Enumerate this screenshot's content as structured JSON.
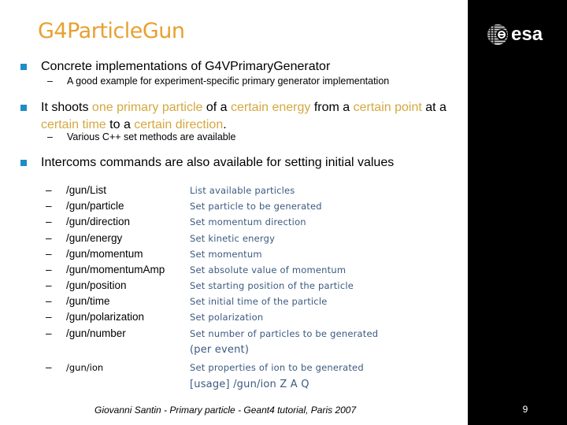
{
  "slide": {
    "title": "G4ParticleGun",
    "page_number": "9",
    "footer": "Giovanni Santin  -  Primary particle  -  Geant4 tutorial, Paris 2007",
    "logo": {
      "icon": "esa-globe-icon",
      "text": "esa"
    },
    "colors": {
      "title": "#E8A030",
      "bullet": "#1E8CC8",
      "highlight": "#D4A840",
      "description": "#3A5A80",
      "side_panel": "#000000"
    }
  },
  "bullets": [
    {
      "text": "Concrete implementations of G4VPrimaryGenerator",
      "sub": "A good example for experiment-specific primary generator implementation"
    },
    {
      "segments": [
        {
          "text": "It shoots ",
          "highlight": false
        },
        {
          "text": "one primary particle",
          "highlight": true
        },
        {
          "text": " of a ",
          "highlight": false
        },
        {
          "text": "certain energy",
          "highlight": true
        },
        {
          "text": " from a ",
          "highlight": false
        },
        {
          "text": "certain point",
          "highlight": true
        },
        {
          "text": " at a ",
          "highlight": false
        },
        {
          "text": "certain time",
          "highlight": true
        },
        {
          "text": " to a ",
          "highlight": false
        },
        {
          "text": "certain direction",
          "highlight": true
        },
        {
          "text": ".",
          "highlight": false
        }
      ],
      "sub": "Various C++ set methods are available"
    },
    {
      "text": "Intercoms commands are also available for setting initial values"
    }
  ],
  "dash": "–",
  "commands": [
    {
      "cmd": "/gun/List",
      "desc": "List available particles"
    },
    {
      "cmd": "/gun/particle",
      "desc": "Set particle to be generated"
    },
    {
      "cmd": "/gun/direction",
      "desc": "Set momentum direction"
    },
    {
      "cmd": "/gun/energy",
      "desc": "Set kinetic energy"
    },
    {
      "cmd": "/gun/momentum",
      "desc": "Set momentum"
    },
    {
      "cmd": "/gun/momentumAmp",
      "desc": "Set absolute value of momentum"
    },
    {
      "cmd": "/gun/position",
      "desc": "Set starting position of the particle"
    },
    {
      "cmd": "/gun/time",
      "desc": "Set initial time of the particle"
    },
    {
      "cmd": "/gun/polarization",
      "desc": "Set polarization"
    },
    {
      "cmd": "/gun/number",
      "desc": "Set number of particles to be generated",
      "desc2": "(per event)"
    },
    {
      "cmd": "/gun/ion",
      "desc": "Set properties of ion to be generated",
      "desc2": "[usage] /gun/ion Z A Q"
    }
  ]
}
